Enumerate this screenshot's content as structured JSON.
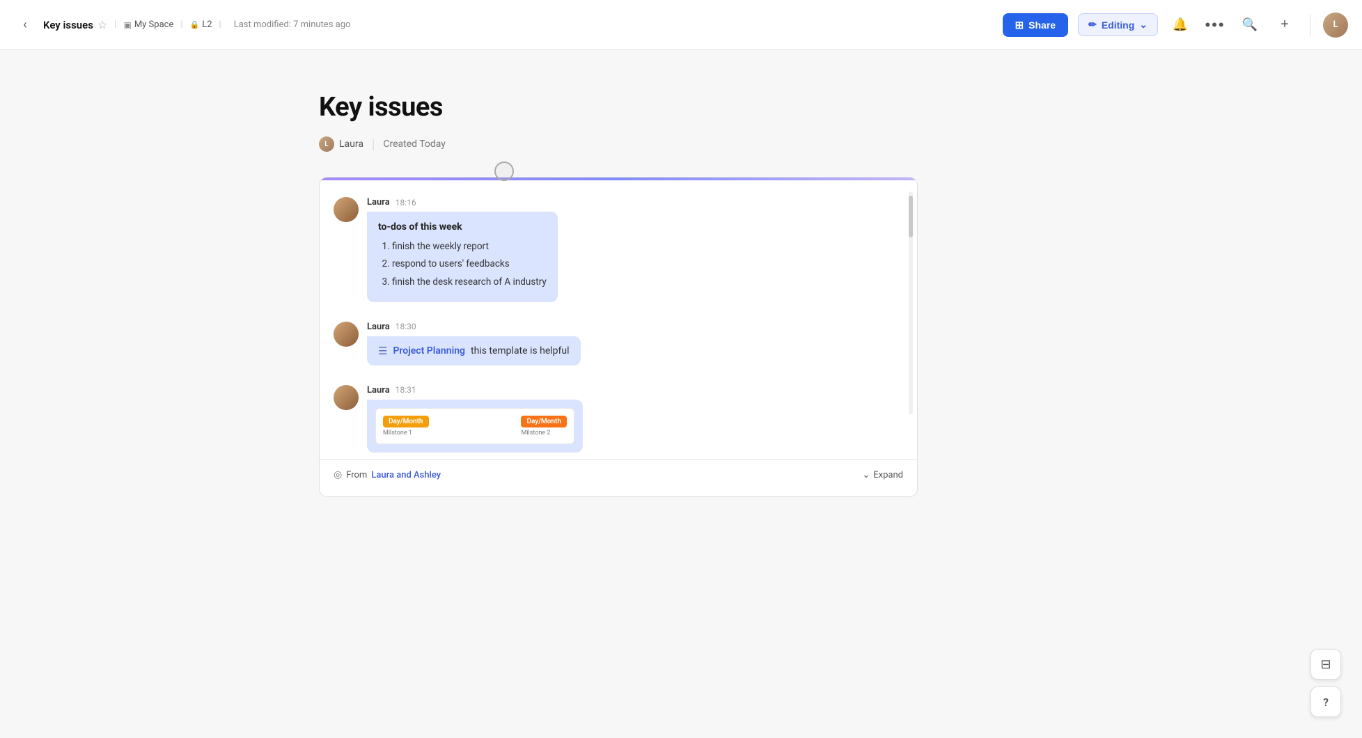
{
  "topbar": {
    "back_icon": "‹",
    "page_title": "Key issues",
    "star_icon": "☆",
    "space_icon": "▣",
    "space_label": "My Space",
    "level_icon": "🔒",
    "level_label": "L2",
    "last_modified": "Last modified: 7 minutes ago",
    "share_label": "Share",
    "share_icon": "⊞",
    "editing_icon": "✏",
    "editing_label": "Editing",
    "editing_dropdown_icon": "⌄",
    "bell_icon": "🔔",
    "more_icon": "···",
    "search_icon": "🔍",
    "plus_icon": "+",
    "avatar_initials": "L"
  },
  "page": {
    "title": "Key issues",
    "author": "Laura",
    "created_label": "Created Today"
  },
  "chat": {
    "messages": [
      {
        "author": "Laura",
        "time": "18:16",
        "type": "list",
        "bubble_title": "to-dos of this week",
        "list_items": [
          "finish the weekly report",
          "respond to users' feedbacks",
          "finish the desk research of A industry"
        ]
      },
      {
        "author": "Laura",
        "time": "18:30",
        "type": "link",
        "link_text": "Project Planning",
        "trailing_text": "this template is helpful"
      },
      {
        "author": "Laura",
        "time": "18:31",
        "type": "image",
        "timeline_tasks": [
          {
            "label": "Day/Month\nMilstone 1",
            "color": "yellow"
          },
          {
            "label": "Day/Month\nMilstone 2",
            "color": "orange"
          }
        ]
      }
    ],
    "footer_from_label": "From",
    "footer_from_people": "Laura and Ashley",
    "expand_icon": "⌄",
    "expand_label": "Expand"
  },
  "fab": {
    "save_icon": "⊟",
    "help_icon": "?"
  }
}
